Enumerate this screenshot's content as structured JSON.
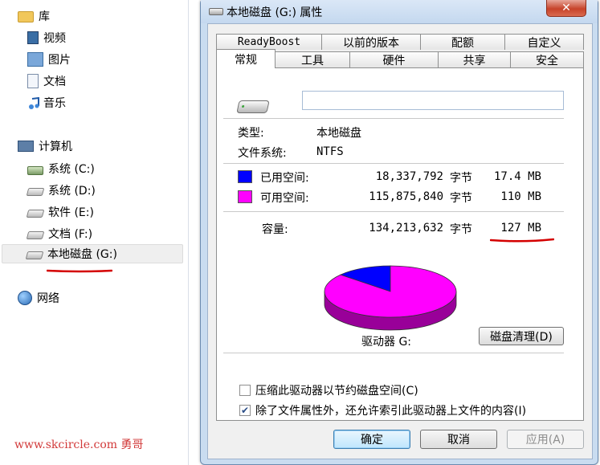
{
  "nav": {
    "items": [
      {
        "label": "库",
        "icon": "library-folder-icon"
      },
      {
        "label": "视频",
        "icon": "video-library-icon"
      },
      {
        "label": "图片",
        "icon": "picture-library-icon"
      },
      {
        "label": "文档",
        "icon": "document-library-icon"
      },
      {
        "label": "音乐",
        "icon": "music-library-icon"
      },
      {
        "label": "计算机",
        "icon": "computer-icon"
      },
      {
        "label": "系统 (C:)",
        "icon": "system-drive-icon"
      },
      {
        "label": "系统 (D:)",
        "icon": "drive-icon"
      },
      {
        "label": "软件 (E:)",
        "icon": "drive-icon"
      },
      {
        "label": "文档 (F:)",
        "icon": "drive-icon"
      },
      {
        "label": "本地磁盘 (G:)",
        "icon": "drive-icon",
        "selected": true
      },
      {
        "label": "网络",
        "icon": "network-globe-icon"
      }
    ]
  },
  "watermark": "www.skcircle.com 勇哥",
  "dialog": {
    "title": "本地磁盘 (G:) 属性",
    "close_glyph": "✕",
    "tabs_back": [
      "ReadyBoost",
      "以前的版本",
      "配额",
      "自定义"
    ],
    "tabs_front": [
      "常规",
      "工具",
      "硬件",
      "共享",
      "安全"
    ],
    "active_tab": "常规",
    "volume_label": "",
    "type_label": "类型:",
    "type_value": "本地磁盘",
    "fs_label": "文件系统:",
    "fs_value": "NTFS",
    "used": {
      "label": "已用空间:",
      "bytes": "18,337,792",
      "unit": "字节",
      "size": "17.4 MB",
      "color": "#0000ff"
    },
    "free": {
      "label": "可用空间:",
      "bytes": "115,875,840",
      "unit": "字节",
      "size": "110 MB",
      "color": "#ff00ff"
    },
    "capacity": {
      "label": "容量:",
      "bytes": "134,213,632",
      "unit": "字节",
      "size": "127 MB"
    },
    "drive_caption": "驱动器 G:",
    "cleanup_button": "磁盘清理(D)",
    "compress_checkbox": {
      "label": "压缩此驱动器以节约磁盘空间(C)",
      "checked": false
    },
    "index_checkbox": {
      "label": "除了文件属性外，还允许索引此驱动器上文件的内容(I)",
      "checked": true
    },
    "buttons": {
      "ok": "确定",
      "cancel": "取消",
      "apply": "应用(A)"
    }
  },
  "chart_data": {
    "type": "pie",
    "categories": [
      "已用空间",
      "可用空间"
    ],
    "values": [
      18337792,
      115875840
    ],
    "colors": [
      "#0000ff",
      "#ff00ff"
    ],
    "title": "驱动器 G:"
  },
  "colors": {
    "annotation_red": "#d40000",
    "dialog_frame": "#c9dcf0"
  }
}
